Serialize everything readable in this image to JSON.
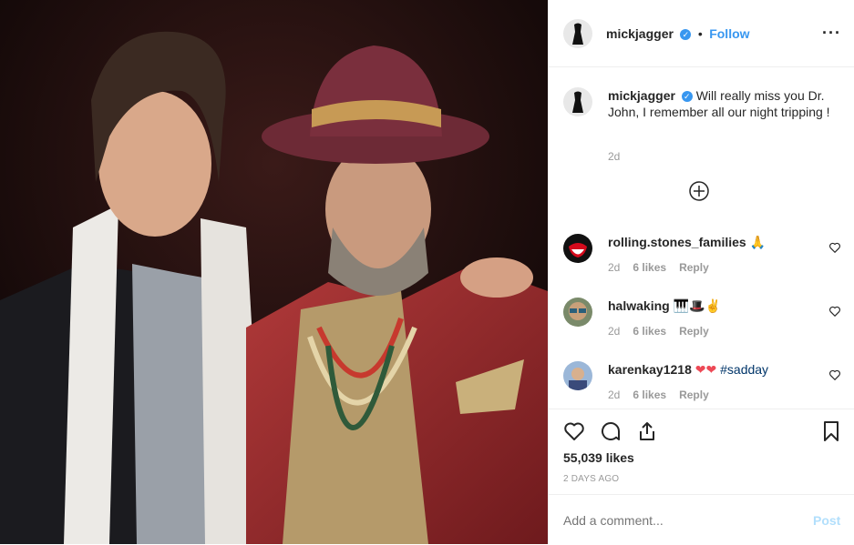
{
  "post": {
    "username": "mickjagger",
    "follow_label": "Follow",
    "more_icon": "more-horizontal-icon",
    "caption_user": "mickjagger",
    "caption_text": "Will really miss you Dr. John, I remember all our night tripping !",
    "caption_time": "2d",
    "load_more_icon": "plus-circle-icon"
  },
  "comments": [
    {
      "user": "rolling.stones_families",
      "text": "🙏",
      "time": "2d",
      "likes": "6 likes",
      "reply": "Reply"
    },
    {
      "user": "halwaking",
      "text": "🎹🎩✌",
      "time": "2d",
      "likes": "6 likes",
      "reply": "Reply"
    },
    {
      "user": "karenkay1218",
      "text": "❤❤",
      "hashtag": "#sadday",
      "time": "2d",
      "likes": "6 likes",
      "reply": "Reply"
    }
  ],
  "stats": {
    "likes": "55,039 likes",
    "date": "2 DAYS AGO"
  },
  "composer": {
    "placeholder": "Add a comment...",
    "post_label": "Post"
  },
  "colors": {
    "accent": "#3897f0",
    "muted": "#999999",
    "like_red": "#ed4956"
  }
}
